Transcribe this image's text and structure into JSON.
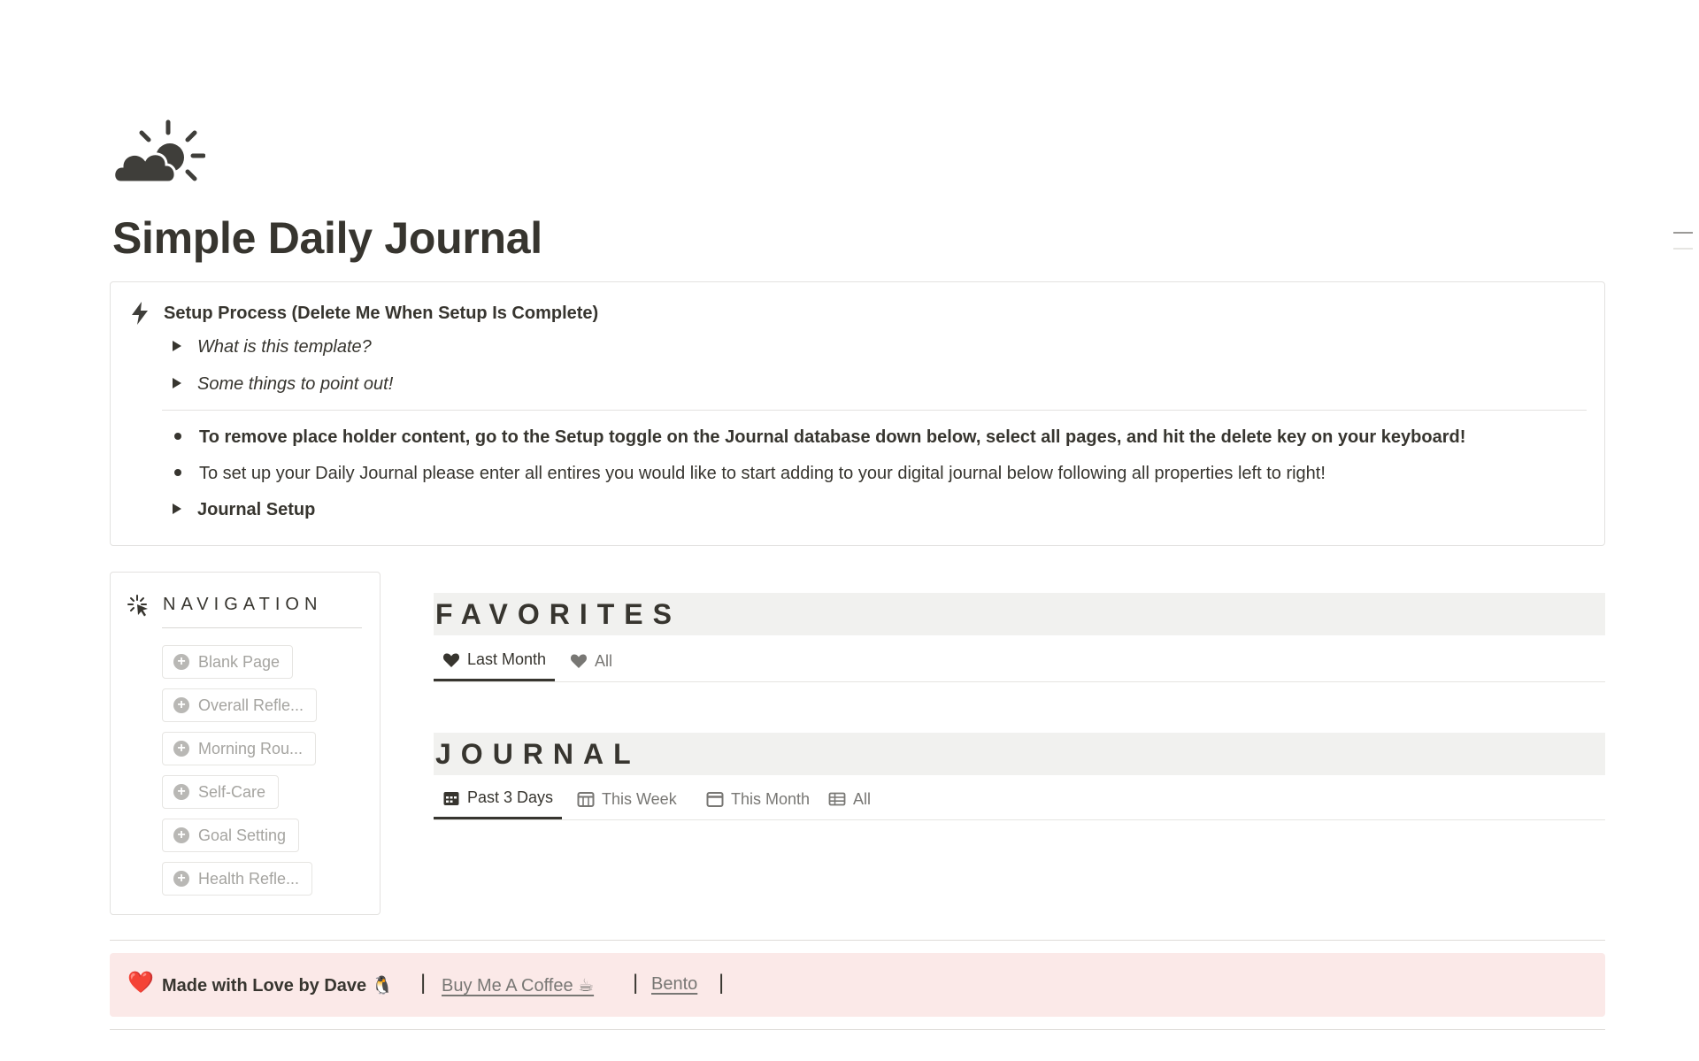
{
  "page": {
    "icon": "sun-behind-cloud-icon",
    "title": "Simple Daily Journal"
  },
  "setup_callout": {
    "icon": "bolt-icon",
    "title": "Setup Process (Delete Me When Setup Is Complete)",
    "toggles": [
      "What is this template?",
      "Some things to point out!"
    ],
    "bullets": [
      "To remove place holder content, go to the Setup toggle on the Journal database down below, select all pages, and hit the delete key on your keyboard!",
      "To set up your Daily Journal please enter all entires you would like to start adding to your digital journal below following all properties left to right!"
    ],
    "journal_setup_toggle": "Journal Setup"
  },
  "navigation": {
    "icon": "cursor-click-icon",
    "heading": "NAVIGATION",
    "buttons": [
      "Blank Page",
      "Overall Refle...",
      "Morning Rou...",
      "Self-Care",
      "Goal Setting",
      "Health Refle..."
    ]
  },
  "favorites": {
    "heading": "FAVORITES",
    "tabs": [
      {
        "label": "Last Month",
        "icon": "heart-icon",
        "active": true
      },
      {
        "label": "All",
        "icon": "heart-icon",
        "active": false
      }
    ]
  },
  "journal": {
    "heading": "JOURNAL",
    "tabs": [
      {
        "label": "Past 3 Days",
        "icon": "calendar-icon",
        "active": true
      },
      {
        "label": "This Week",
        "icon": "calendar-week-icon",
        "active": false
      },
      {
        "label": "This Month",
        "icon": "calendar-icon",
        "active": false
      },
      {
        "label": "All",
        "icon": "table-icon",
        "active": false
      }
    ]
  },
  "footer": {
    "heart": "❤️",
    "made_by": "Made with Love by Dave 🐧",
    "separator": "|",
    "links": [
      "Buy Me A Coffee ☕",
      "Bento"
    ]
  },
  "colors": {
    "text": "#37352f",
    "muted": "#787774",
    "section_bg": "#f1f1ef",
    "footer_bg": "#fbe9e8",
    "heart": "#e03e3e"
  }
}
